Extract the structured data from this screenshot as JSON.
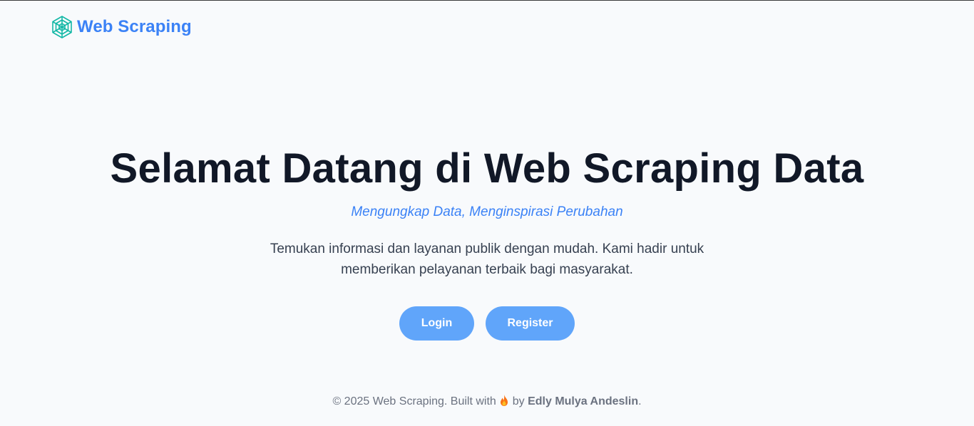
{
  "brand": {
    "name": "Web Scraping",
    "logo_icon": "web-hexagon-icon",
    "color": "#3b82f6",
    "logo_color": "#14b8a6"
  },
  "hero": {
    "title": "Selamat Datang di Web Scraping Data",
    "tagline": "Mengungkap Data, Menginspirasi Perubahan",
    "description": "Temukan informasi dan layanan publik dengan mudah. Kami hadir untuk memberikan pelayanan terbaik bagi masyarakat."
  },
  "actions": {
    "login_label": "Login",
    "register_label": "Register",
    "button_color": "#60a5fa"
  },
  "footer": {
    "prefix": "© 2025 Web Scraping. Built with",
    "icon": "fire-icon",
    "by": "by",
    "author": "Edly Mulya Andeslin",
    "suffix": "."
  }
}
